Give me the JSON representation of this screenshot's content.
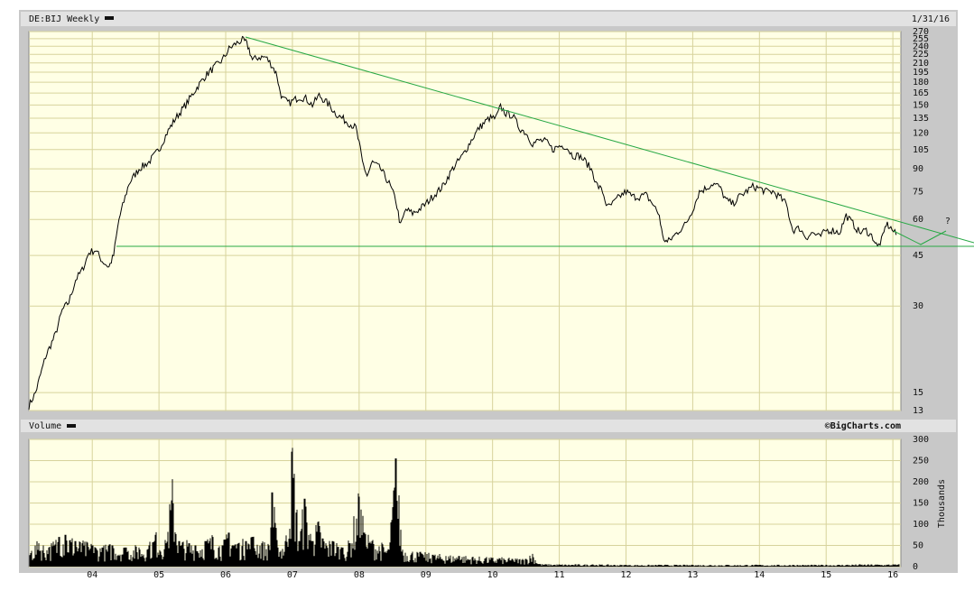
{
  "header": {
    "symbol_label": "DE:BIJ Weekly",
    "date_label": "1/31/16",
    "volume_label": "Volume",
    "credit": "©BigCharts.com",
    "volume_unit": "Thousands",
    "annotation": "?"
  },
  "colors": {
    "frame": "#c8c8c8",
    "header_bar": "#e2e2e2",
    "plot_bg": "#ffffe5",
    "grid": "#d7d39c",
    "price_line": "#000000",
    "trend_line": "#27a844",
    "annotation": "#27a844"
  },
  "chart_data": [
    {
      "type": "line",
      "title": "DE:BIJ Weekly",
      "yscale": "log",
      "ylim": [
        13,
        270
      ],
      "xlim": [
        2003.05,
        2016.12
      ],
      "x_tick_labels": [
        "04",
        "05",
        "06",
        "07",
        "08",
        "09",
        "10",
        "11",
        "12",
        "13",
        "14",
        "15",
        "16"
      ],
      "x_tick_years": [
        2004,
        2005,
        2006,
        2007,
        2008,
        2009,
        2010,
        2011,
        2012,
        2013,
        2014,
        2015,
        2016
      ],
      "y_ticks": [
        13,
        15,
        30,
        45,
        60,
        75,
        90,
        105,
        120,
        135,
        150,
        165,
        180,
        195,
        210,
        225,
        240,
        255,
        270
      ],
      "grid": true,
      "series": [
        {
          "points": [
            [
              2003.05,
              13.5
            ],
            [
              2003.15,
              15
            ],
            [
              2003.3,
              20
            ],
            [
              2003.45,
              24
            ],
            [
              2003.55,
              29
            ],
            [
              2003.65,
              31
            ],
            [
              2003.75,
              37
            ],
            [
              2003.85,
              40
            ],
            [
              2003.95,
              46
            ],
            [
              2004.05,
              47
            ],
            [
              2004.15,
              43
            ],
            [
              2004.25,
              41
            ],
            [
              2004.32,
              45
            ],
            [
              2004.4,
              60
            ],
            [
              2004.55,
              80
            ],
            [
              2004.7,
              90
            ],
            [
              2004.85,
              95
            ],
            [
              2005.0,
              105
            ],
            [
              2005.12,
              120
            ],
            [
              2005.25,
              135
            ],
            [
              2005.4,
              150
            ],
            [
              2005.55,
              170
            ],
            [
              2005.7,
              190
            ],
            [
              2005.85,
              205
            ],
            [
              2005.95,
              215
            ],
            [
              2006.05,
              235
            ],
            [
              2006.15,
              245
            ],
            [
              2006.25,
              252
            ],
            [
              2006.3,
              248
            ],
            [
              2006.35,
              235
            ],
            [
              2006.4,
              215
            ],
            [
              2006.5,
              220
            ],
            [
              2006.6,
              220
            ],
            [
              2006.7,
              205
            ],
            [
              2006.77,
              190
            ],
            [
              2006.8,
              172
            ],
            [
              2006.85,
              158
            ],
            [
              2006.95,
              152
            ],
            [
              2007.1,
              160
            ],
            [
              2007.2,
              158
            ],
            [
              2007.3,
              150
            ],
            [
              2007.4,
              162
            ],
            [
              2007.55,
              150
            ],
            [
              2007.65,
              140
            ],
            [
              2007.8,
              132
            ],
            [
              2007.95,
              125
            ],
            [
              2008.0,
              110
            ],
            [
              2008.05,
              95
            ],
            [
              2008.12,
              85
            ],
            [
              2008.2,
              95
            ],
            [
              2008.32,
              90
            ],
            [
              2008.45,
              80
            ],
            [
              2008.55,
              70
            ],
            [
              2008.62,
              57
            ],
            [
              2008.7,
              65
            ],
            [
              2008.8,
              63
            ],
            [
              2008.9,
              65
            ],
            [
              2009.0,
              68
            ],
            [
              2009.1,
              72
            ],
            [
              2009.25,
              78
            ],
            [
              2009.4,
              90
            ],
            [
              2009.55,
              100
            ],
            [
              2009.7,
              115
            ],
            [
              2009.8,
              125
            ],
            [
              2009.95,
              135
            ],
            [
              2010.05,
              135
            ],
            [
              2010.12,
              148
            ],
            [
              2010.2,
              140
            ],
            [
              2010.3,
              138
            ],
            [
              2010.4,
              125
            ],
            [
              2010.5,
              120
            ],
            [
              2010.6,
              110
            ],
            [
              2010.7,
              113
            ],
            [
              2010.8,
              112
            ],
            [
              2010.9,
              105
            ],
            [
              2011.0,
              108
            ],
            [
              2011.1,
              108
            ],
            [
              2011.2,
              100
            ],
            [
              2011.3,
              100
            ],
            [
              2011.4,
              95
            ],
            [
              2011.5,
              88
            ],
            [
              2011.55,
              80
            ],
            [
              2011.65,
              75
            ],
            [
              2011.72,
              66
            ],
            [
              2011.8,
              68
            ],
            [
              2011.9,
              72
            ],
            [
              2012.0,
              75
            ],
            [
              2012.1,
              72
            ],
            [
              2012.2,
              72
            ],
            [
              2012.3,
              73
            ],
            [
              2012.4,
              68
            ],
            [
              2012.5,
              62
            ],
            [
              2012.55,
              52
            ],
            [
              2012.62,
              50
            ],
            [
              2012.7,
              52
            ],
            [
              2012.8,
              55
            ],
            [
              2012.9,
              58
            ],
            [
              2013.0,
              65
            ],
            [
              2013.1,
              75
            ],
            [
              2013.2,
              77
            ],
            [
              2013.3,
              80
            ],
            [
              2013.4,
              78
            ],
            [
              2013.5,
              70
            ],
            [
              2013.6,
              68
            ],
            [
              2013.7,
              72
            ],
            [
              2013.8,
              75
            ],
            [
              2013.9,
              78
            ],
            [
              2014.0,
              77
            ],
            [
              2014.1,
              75
            ],
            [
              2014.2,
              75
            ],
            [
              2014.3,
              72
            ],
            [
              2014.4,
              68
            ],
            [
              2014.5,
              55
            ],
            [
              2014.6,
              56
            ],
            [
              2014.7,
              52
            ],
            [
              2014.8,
              54
            ],
            [
              2014.9,
              52
            ],
            [
              2015.0,
              55
            ],
            [
              2015.1,
              55
            ],
            [
              2015.2,
              54
            ],
            [
              2015.3,
              62
            ],
            [
              2015.4,
              58
            ],
            [
              2015.5,
              54
            ],
            [
              2015.6,
              55
            ],
            [
              2015.7,
              52
            ],
            [
              2015.77,
              48
            ],
            [
              2015.85,
              52
            ],
            [
              2015.9,
              58
            ],
            [
              2015.97,
              56
            ],
            [
              2016.05,
              53
            ]
          ]
        }
      ]
    },
    {
      "type": "bar",
      "title": "Volume",
      "ylabel": "Thousands",
      "ylim": [
        0,
        300
      ],
      "y_ticks": [
        0,
        50,
        100,
        150,
        200,
        250,
        300
      ],
      "xlim": [
        2003.05,
        2016.12
      ],
      "grid": true,
      "series": [
        {
          "points": [
            [
              2003.05,
              40
            ],
            [
              2003.2,
              55
            ],
            [
              2003.35,
              45
            ],
            [
              2003.5,
              70
            ],
            [
              2003.6,
              75
            ],
            [
              2003.75,
              60
            ],
            [
              2003.85,
              55
            ],
            [
              2004.0,
              50
            ],
            [
              2004.15,
              45
            ],
            [
              2004.3,
              50
            ],
            [
              2004.5,
              45
            ],
            [
              2004.7,
              45
            ],
            [
              2004.85,
              50
            ],
            [
              2004.95,
              75
            ],
            [
              2005.1,
              55
            ],
            [
              2005.2,
              190
            ],
            [
              2005.3,
              60
            ],
            [
              2005.45,
              55
            ],
            [
              2005.55,
              50
            ],
            [
              2005.7,
              60
            ],
            [
              2005.8,
              70
            ],
            [
              2005.95,
              50
            ],
            [
              2006.05,
              80
            ],
            [
              2006.2,
              55
            ],
            [
              2006.3,
              60
            ],
            [
              2006.4,
              70
            ],
            [
              2006.55,
              55
            ],
            [
              2006.65,
              50
            ],
            [
              2006.7,
              175
            ],
            [
              2006.78,
              45
            ],
            [
              2006.9,
              60
            ],
            [
              2007.0,
              280
            ],
            [
              2007.1,
              60
            ],
            [
              2007.18,
              160
            ],
            [
              2007.3,
              60
            ],
            [
              2007.38,
              105
            ],
            [
              2007.5,
              55
            ],
            [
              2007.6,
              60
            ],
            [
              2007.75,
              45
            ],
            [
              2007.85,
              55
            ],
            [
              2008.0,
              165
            ],
            [
              2008.08,
              80
            ],
            [
              2008.2,
              60
            ],
            [
              2008.35,
              50
            ],
            [
              2008.45,
              40
            ],
            [
              2008.55,
              255
            ],
            [
              2008.65,
              40
            ],
            [
              2008.8,
              35
            ],
            [
              2008.95,
              30
            ],
            [
              2009.1,
              28
            ],
            [
              2009.3,
              25
            ],
            [
              2009.5,
              25
            ],
            [
              2009.7,
              22
            ],
            [
              2009.9,
              20
            ],
            [
              2010.1,
              20
            ],
            [
              2010.3,
              18
            ],
            [
              2010.5,
              18
            ],
            [
              2010.6,
              30
            ],
            [
              2010.7,
              6
            ],
            [
              2011.0,
              5
            ],
            [
              2011.5,
              5
            ],
            [
              2012.0,
              4
            ],
            [
              2012.5,
              4
            ],
            [
              2013.0,
              4
            ],
            [
              2013.5,
              4
            ],
            [
              2014.0,
              4
            ],
            [
              2014.5,
              4
            ],
            [
              2015.0,
              4
            ],
            [
              2015.5,
              5
            ],
            [
              2016.0,
              5
            ]
          ]
        }
      ]
    }
  ]
}
